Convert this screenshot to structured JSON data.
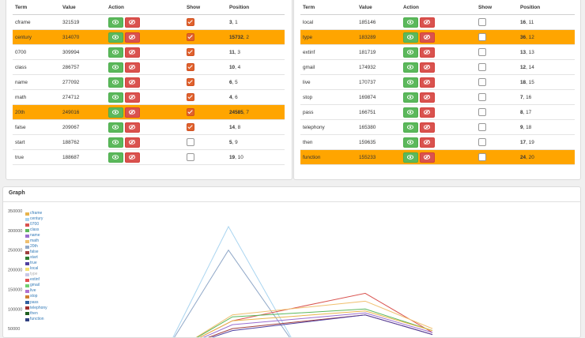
{
  "table_headers": {
    "term": "Term",
    "value": "Value",
    "action": "Action",
    "show": "Show",
    "position": "Position"
  },
  "left_rows": [
    {
      "term": "cframe",
      "value": "321519",
      "show": true,
      "rank": "3",
      "pos": ", 1",
      "highlight": false
    },
    {
      "term": "century",
      "value": "314070",
      "show": true,
      "rank": "15732",
      "pos": ", 2",
      "highlight": true
    },
    {
      "term": "0700",
      "value": "309994",
      "show": true,
      "rank": "11",
      "pos": ", 3",
      "highlight": false
    },
    {
      "term": "class",
      "value": "286757",
      "show": true,
      "rank": "10",
      "pos": ", 4",
      "highlight": false
    },
    {
      "term": "name",
      "value": "277092",
      "show": true,
      "rank": "6",
      "pos": ", 5",
      "highlight": false
    },
    {
      "term": "math",
      "value": "274712",
      "show": true,
      "rank": "4",
      "pos": ", 6",
      "highlight": false
    },
    {
      "term": "20th",
      "value": "249016",
      "show": true,
      "rank": "24585",
      "pos": ", 7",
      "highlight": true
    },
    {
      "term": "false",
      "value": "209067",
      "show": true,
      "rank": "14",
      "pos": ", 8",
      "highlight": false
    },
    {
      "term": "start",
      "value": "188762",
      "show": false,
      "rank": "5",
      "pos": ", 9",
      "highlight": false
    },
    {
      "term": "true",
      "value": "188687",
      "show": false,
      "rank": "19",
      "pos": ", 10",
      "highlight": false
    }
  ],
  "right_rows": [
    {
      "term": "local",
      "value": "185146",
      "show": false,
      "rank": "16",
      "pos": ", 11",
      "highlight": false
    },
    {
      "term": "type",
      "value": "183289",
      "show": false,
      "rank": "36",
      "pos": ", 12",
      "highlight": true
    },
    {
      "term": "extinf",
      "value": "181719",
      "show": false,
      "rank": "13",
      "pos": ", 13",
      "highlight": false
    },
    {
      "term": "gmail",
      "value": "174932",
      "show": false,
      "rank": "12",
      "pos": ", 14",
      "highlight": false
    },
    {
      "term": "live",
      "value": "170737",
      "show": false,
      "rank": "18",
      "pos": ", 15",
      "highlight": false
    },
    {
      "term": "stop",
      "value": "169874",
      "show": false,
      "rank": "7",
      "pos": ", 16",
      "highlight": false
    },
    {
      "term": "pass",
      "value": "166751",
      "show": false,
      "rank": "8",
      "pos": ", 17",
      "highlight": false
    },
    {
      "term": "telephony",
      "value": "165380",
      "show": false,
      "rank": "9",
      "pos": ", 18",
      "highlight": false
    },
    {
      "term": "then",
      "value": "159635",
      "show": false,
      "rank": "17",
      "pos": ", 19",
      "highlight": false
    },
    {
      "term": "function",
      "value": "155233",
      "show": false,
      "rank": "24",
      "pos": ", 20",
      "highlight": true
    }
  ],
  "icons": {
    "show_button": "eye-icon",
    "hide_button": "eye-slash-icon"
  },
  "colors": {
    "highlight": "#ffa500",
    "show_button": "#5cb85c",
    "hide_button": "#d9534f",
    "checked": "#e0622e"
  },
  "graph": {
    "title": "Graph",
    "y_ticks": [
      "350000",
      "300000",
      "250000",
      "200000",
      "150000",
      "100000",
      "50000"
    ],
    "legend": [
      {
        "name": "cframe",
        "color": "#e8b44c",
        "active": true
      },
      {
        "name": "century",
        "color": "#a8d4f0",
        "active": true
      },
      {
        "name": "0700",
        "color": "#d9534f",
        "active": true
      },
      {
        "name": "class",
        "color": "#5cb85c",
        "active": true
      },
      {
        "name": "name",
        "color": "#9b6fd0",
        "active": true
      },
      {
        "name": "math",
        "color": "#f0c070",
        "active": true
      },
      {
        "name": "20th",
        "color": "#90a8c8",
        "active": true
      },
      {
        "name": "false",
        "color": "#a04040",
        "active": true
      },
      {
        "name": "start",
        "color": "#2e7d32",
        "active": true
      },
      {
        "name": "true",
        "color": "#5040a0",
        "active": true
      },
      {
        "name": "local",
        "color": "#f5e070",
        "active": true
      },
      {
        "name": "type",
        "color": "#c8c8e8",
        "active": false
      },
      {
        "name": "extinf",
        "color": "#e05050",
        "active": true
      },
      {
        "name": "gmail",
        "color": "#70d070",
        "active": true
      },
      {
        "name": "live",
        "color": "#b070d0",
        "active": true
      },
      {
        "name": "stop",
        "color": "#d08030",
        "active": true
      },
      {
        "name": "pass",
        "color": "#3060a0",
        "active": true
      },
      {
        "name": "telephony",
        "color": "#a03030",
        "active": true
      },
      {
        "name": "then",
        "color": "#206020",
        "active": true
      },
      {
        "name": "function",
        "color": "#304080",
        "active": true
      }
    ]
  },
  "chart_data": {
    "type": "line",
    "title": "Graph",
    "ylim": [
      0,
      350000
    ],
    "y_ticks": [
      50000,
      100000,
      150000,
      200000,
      250000,
      300000,
      350000
    ],
    "series": [
      {
        "name": "century",
        "color": "#a8d4f0",
        "values": [
          0,
          310000,
          0
        ]
      },
      {
        "name": "20th",
        "color": "#90a8c8",
        "values": [
          0,
          250000,
          0
        ]
      },
      {
        "name": "0700",
        "color": "#d9534f",
        "values": [
          0,
          70000,
          140000,
          40000
        ]
      },
      {
        "name": "math",
        "color": "#f0c070",
        "values": [
          0,
          85000,
          120000,
          50000
        ]
      },
      {
        "name": "class",
        "color": "#5cb85c",
        "values": [
          0,
          80000,
          100000,
          45000
        ]
      },
      {
        "name": "cframe",
        "color": "#e8b44c",
        "values": [
          0,
          70000,
          95000,
          45000
        ]
      },
      {
        "name": "name",
        "color": "#9b6fd0",
        "values": [
          0,
          60000,
          90000,
          40000
        ]
      },
      {
        "name": "false",
        "color": "#a04040",
        "values": [
          0,
          50000,
          85000,
          35000
        ]
      },
      {
        "name": "true",
        "color": "#5040a0",
        "values": [
          0,
          45000,
          85000,
          35000
        ]
      }
    ]
  }
}
